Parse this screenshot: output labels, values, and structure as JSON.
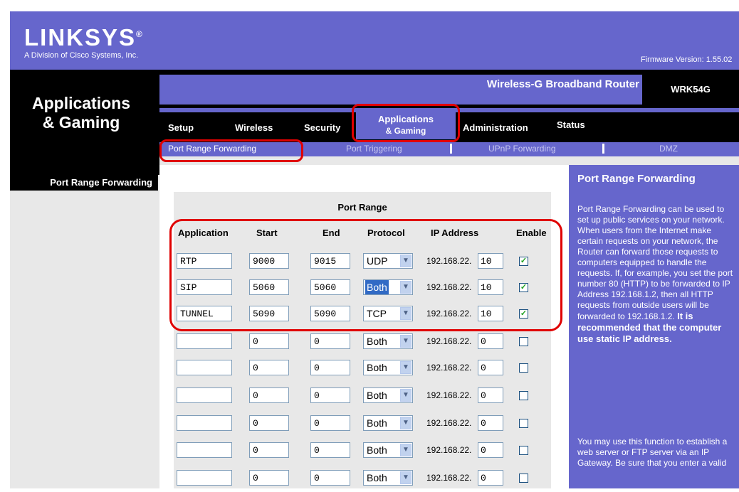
{
  "header": {
    "logo": "LINKSYS",
    "logo_mark": "®",
    "subtitle": "A Division of Cisco Systems, Inc.",
    "firmware": "Firmware Version: 1.55.02"
  },
  "section_title_line1": "Applications",
  "section_title_line2": "& Gaming",
  "product": {
    "name": "Wireless-G Broadband Router",
    "model": "WRK54G"
  },
  "tabs": {
    "setup": "Setup",
    "wireless": "Wireless",
    "security": "Security",
    "applications_line1": "Applications",
    "applications_line2": "& Gaming",
    "administration": "Administration",
    "status": "Status"
  },
  "subtabs": {
    "port_range_forwarding": "Port Range Forwarding",
    "port_triggering": "Port Triggering",
    "upnp_forwarding": "UPnP Forwarding",
    "dmz": "DMZ"
  },
  "left_nav": {
    "item": "Port Range Forwarding"
  },
  "table": {
    "title": "Port Range",
    "headers": {
      "application": "Application",
      "start": "Start",
      "end": "End",
      "protocol": "Protocol",
      "ip_address": "IP Address",
      "enable": "Enable"
    },
    "ip_prefix": "192.168.22.",
    "rows": [
      {
        "application": "RTP",
        "start": "9000",
        "end": "9015",
        "protocol": "UDP",
        "ip_last": "10",
        "enabled": true
      },
      {
        "application": "SIP",
        "start": "5060",
        "end": "5060",
        "protocol": "Both",
        "ip_last": "10",
        "enabled": true
      },
      {
        "application": "TUNNEL",
        "start": "5090",
        "end": "5090",
        "protocol": "TCP",
        "ip_last": "10",
        "enabled": true
      },
      {
        "application": "",
        "start": "0",
        "end": "0",
        "protocol": "Both",
        "ip_last": "0",
        "enabled": false
      },
      {
        "application": "",
        "start": "0",
        "end": "0",
        "protocol": "Both",
        "ip_last": "0",
        "enabled": false
      },
      {
        "application": "",
        "start": "0",
        "end": "0",
        "protocol": "Both",
        "ip_last": "0",
        "enabled": false
      },
      {
        "application": "",
        "start": "0",
        "end": "0",
        "protocol": "Both",
        "ip_last": "0",
        "enabled": false
      },
      {
        "application": "",
        "start": "0",
        "end": "0",
        "protocol": "Both",
        "ip_last": "0",
        "enabled": false
      },
      {
        "application": "",
        "start": "0",
        "end": "0",
        "protocol": "Both",
        "ip_last": "0",
        "enabled": false
      }
    ]
  },
  "help": {
    "title": "Port Range Forwarding",
    "text": "Port Range Forwarding can be used to set up public services on your network. When users from the Internet make certain requests on your network, the Router can forward those requests to computers equipped to handle the requests. If, for example, you set the port number 80 (HTTP) to be forwarded to IP Address 192.168.1.2, then all HTTP requests from outside users will be forwarded to 192.168.1.2.",
    "text_bold": "It is recommended that the computer use static IP address.",
    "text2": "You may use this function to establish a web server or FTP server via an IP Gateway. Be sure that you enter a valid"
  },
  "colors": {
    "brand_purple": "#6666cc",
    "annotation_red": "#e00000"
  }
}
